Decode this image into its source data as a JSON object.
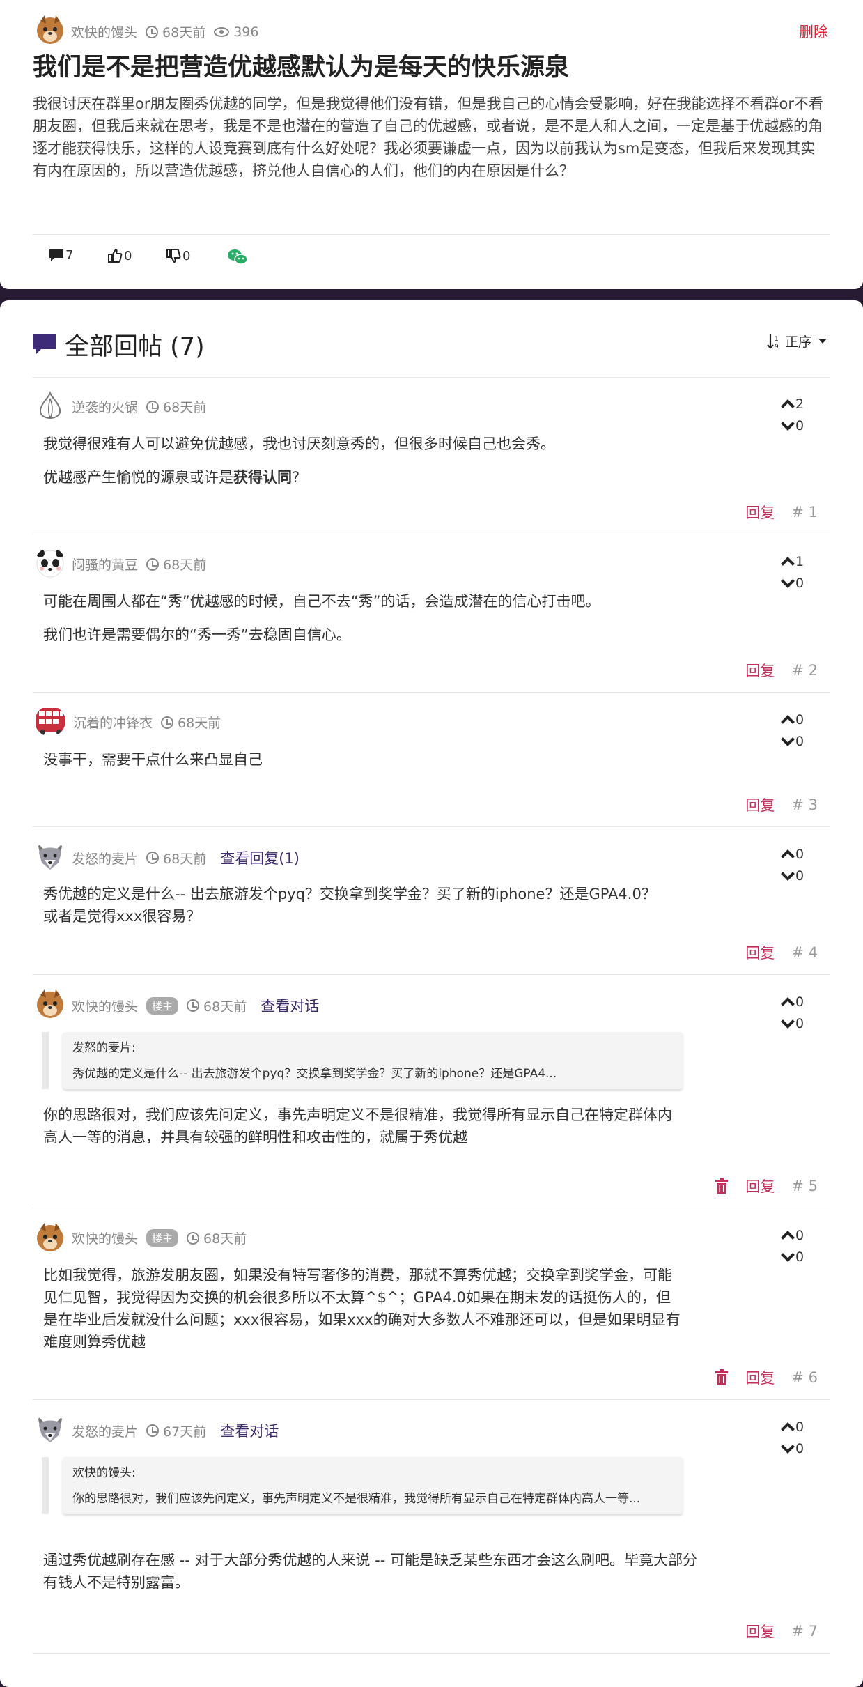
{
  "post": {
    "author": "欢快的馒头",
    "time": "68天前",
    "views": "396",
    "delete_label": "删除",
    "title": "我们是不是把营造优越感默认为是每天的快乐源泉",
    "body": "我很讨厌在群里or朋友圈秀优越的同学，但是我觉得他们没有错，但是我自己的心情会受影响，好在我能选择不看群or不看朋友圈，但我后来就在思考，我是不是也潜在的营造了自己的优越感，或者说，是不是人和人之间，一定是基于优越感的角逐才能获得快乐，这样的人设竞赛到底有什么好处呢？我必须要谦虚一点，因为以前我认为sm是变态，但我后来发现其实有内在原因的，所以营造优越感，挤兑他人自信心的人们，他们的内在原因是什么？",
    "comments_count": "7",
    "likes": "0",
    "dislikes": "0",
    "icons": {
      "comments": "comment-icon",
      "likes": "thumbs-up-icon",
      "dislikes": "thumbs-down-icon",
      "share": "wechat-icon"
    },
    "colors": {
      "delete": "#dd2233",
      "wechat": "#2aae67"
    }
  },
  "replies_header": {
    "title": "全部回帖 (7)",
    "sort_label": "正序"
  },
  "replies": [
    {
      "author": "逆袭的火锅",
      "time": "68天前",
      "up": "2",
      "down": "0",
      "paragraphs": [
        "我觉得很难有人可以避免优越感，我也讨厌刻意秀的，但很多时候自己也会秀。",
        "优越感产生愉悦的源泉或许是"
      ],
      "bold": "获得认同",
      "tail": "?",
      "reply_label": "回复",
      "floor": "# 1"
    },
    {
      "author": "闷骚的黄豆",
      "time": "68天前",
      "up": "1",
      "down": "0",
      "paragraphs": [
        "可能在周围人都在“秀”优越感的时候，自己不去“秀”的话，会造成潜在的信心打击吧。",
        "我们也许是需要偶尔的“秀一秀”去稳固自信心。"
      ],
      "reply_label": "回复",
      "floor": "# 2"
    },
    {
      "author": "沉着的冲锋衣",
      "time": "68天前",
      "up": "0",
      "down": "0",
      "paragraphs": [
        "没事干，需要干点什么来凸显自己"
      ],
      "reply_label": "回复",
      "floor": "# 3"
    },
    {
      "author": "发怒的麦片",
      "time": "68天前",
      "link": "查看回复(1)",
      "up": "0",
      "down": "0",
      "paragraphs": [
        "秀优越的定义是什么-- 出去旅游发个pyq？交换拿到奖学金？买了新的iphone？还是GPA4.0？或者是觉得xxx很容易？"
      ],
      "reply_label": "回复",
      "floor": "# 4"
    },
    {
      "author": "欢快的馒头",
      "badge": "楼主",
      "time": "68天前",
      "link": "查看对话",
      "up": "0",
      "down": "0",
      "quote_author": "发怒的麦片:",
      "quote_text": "秀优越的定义是什么-- 出去旅游发个pyq？交换拿到奖学金？买了新的iphone？还是GPA4...",
      "paragraphs": [
        "你的思路很对，我们应该先问定义，事先声明定义不是很精准，我觉得所有显示自己在特定群体内高人一等的消息，并具有较强的鲜明性和攻击性的，就属于秀优越"
      ],
      "reply_label": "回复",
      "floor": "# 5"
    },
    {
      "author": "欢快的馒头",
      "badge": "楼主",
      "time": "68天前",
      "up": "0",
      "down": "0",
      "paragraphs": [
        "比如我觉得，旅游发朋友圈，如果没有特写奢侈的消费，那就不算秀优越；交换拿到奖学金，可能见仁见智，我觉得因为交换的机会很多所以不太算^$^；GPA4.0如果在期末发的话挺伤人的，但是在毕业后发就没什么问题；xxx很容易，如果xxx的确对大多数人不难那还可以，但是如果明显有难度则算秀优越"
      ],
      "reply_label": "回复",
      "floor": "# 6"
    },
    {
      "author": "发怒的麦片",
      "time": "67天前",
      "link": "查看对话",
      "up": "0",
      "down": "0",
      "quote_author": "欢快的馒头:",
      "quote_text": "你的思路很对，我们应该先问定义，事先声明定义不是很精准，我觉得所有显示自己在特定群体内高人一等...",
      "paragraphs": [
        "通过秀优越刷存在感 -- 对于大部分秀优越的人来说 -- 可能是缺乏某些东西才会这么刷吧。毕竟大部分有钱人不是特别露富。"
      ],
      "reply_label": "回复",
      "floor": "# 7"
    }
  ],
  "colors": {
    "reply_link": "#c0305a",
    "accent": "#3d2b6b",
    "background": "#271b33"
  }
}
